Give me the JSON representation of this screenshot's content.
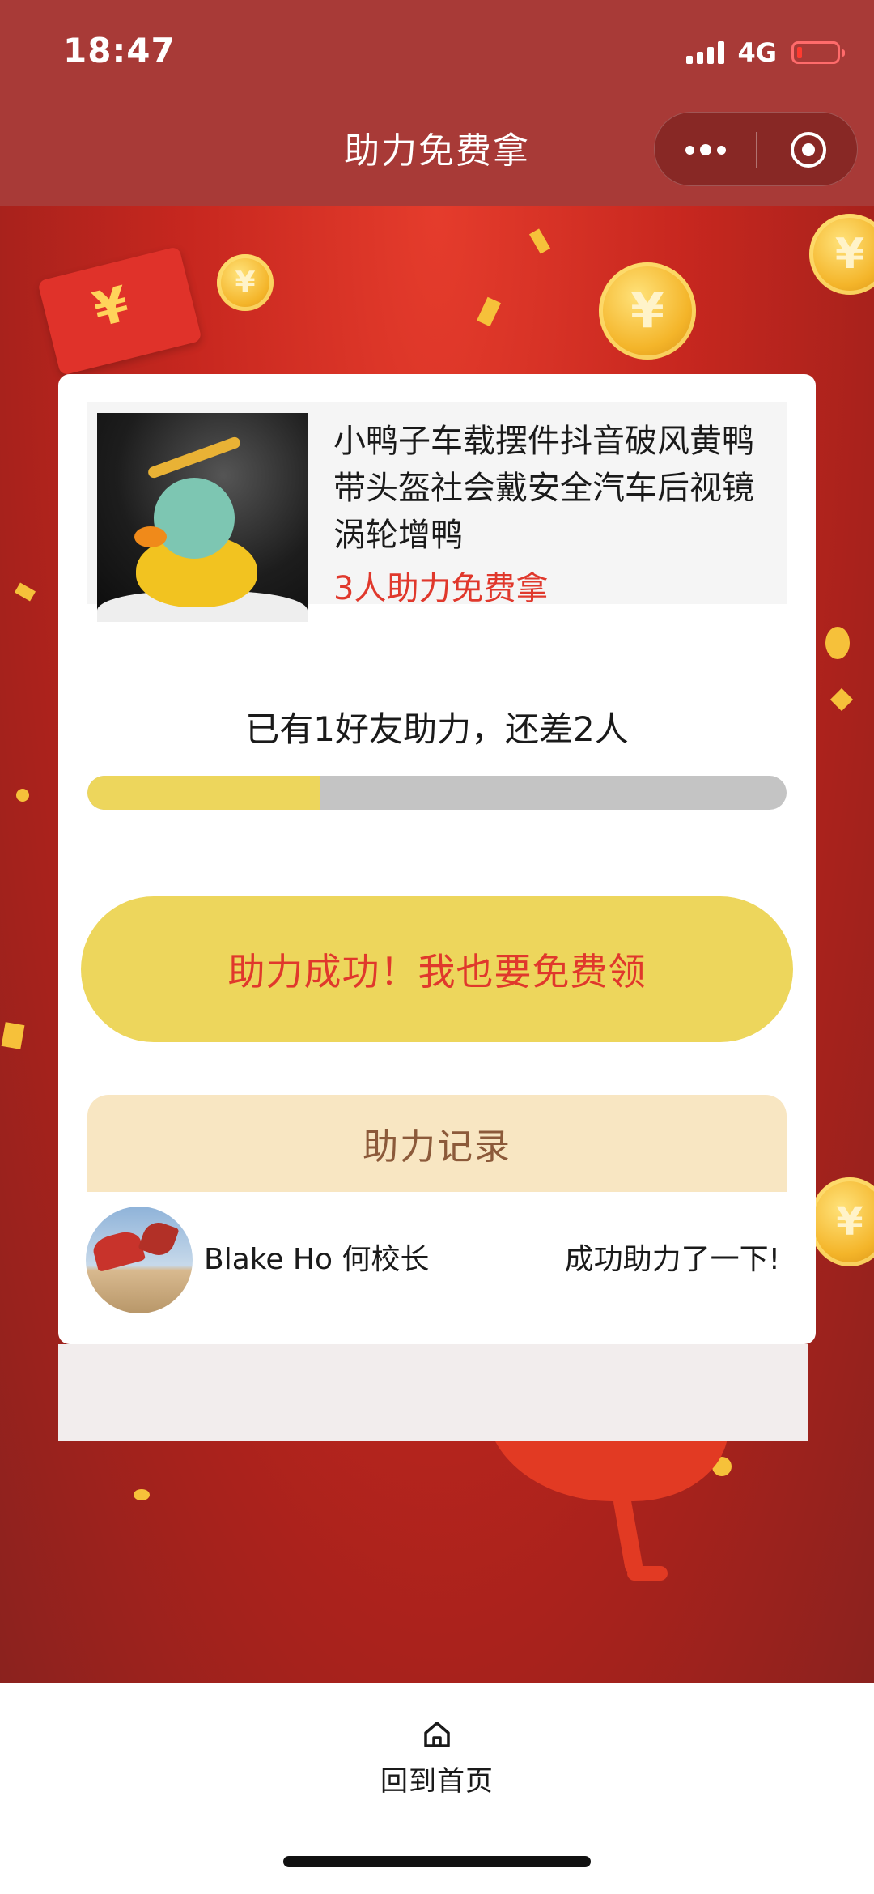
{
  "status_bar": {
    "time": "18:47",
    "network": "4G",
    "battery_color": "#ff3b30"
  },
  "header": {
    "title": "助力免费拿",
    "background": "#a83a37",
    "more_icon": "more-dots-icon",
    "close_icon": "target-close-icon"
  },
  "product": {
    "title": "小鸭子车载摆件抖音破风黄鸭带头盔社会戴安全汽车后视镜涡轮增鸭",
    "promo": "3人助力免费拿",
    "image": "yellow-duck-helmet-image"
  },
  "progress": {
    "text": "已有1好友助力，还差2人",
    "helped": 1,
    "required": 3,
    "fraction": 0.333,
    "fill_color": "#edd65c",
    "track_color": "#c4c4c4"
  },
  "cta": {
    "label": "助力成功！我也要免费领",
    "text_color": "#e0382c"
  },
  "records": {
    "header": "助力记录",
    "items": [
      {
        "name": "Blake Ho 何校长",
        "action": "成功助力了一下!"
      }
    ]
  },
  "bottom_nav": {
    "home_label": "回到首页",
    "home_icon": "home-icon"
  }
}
